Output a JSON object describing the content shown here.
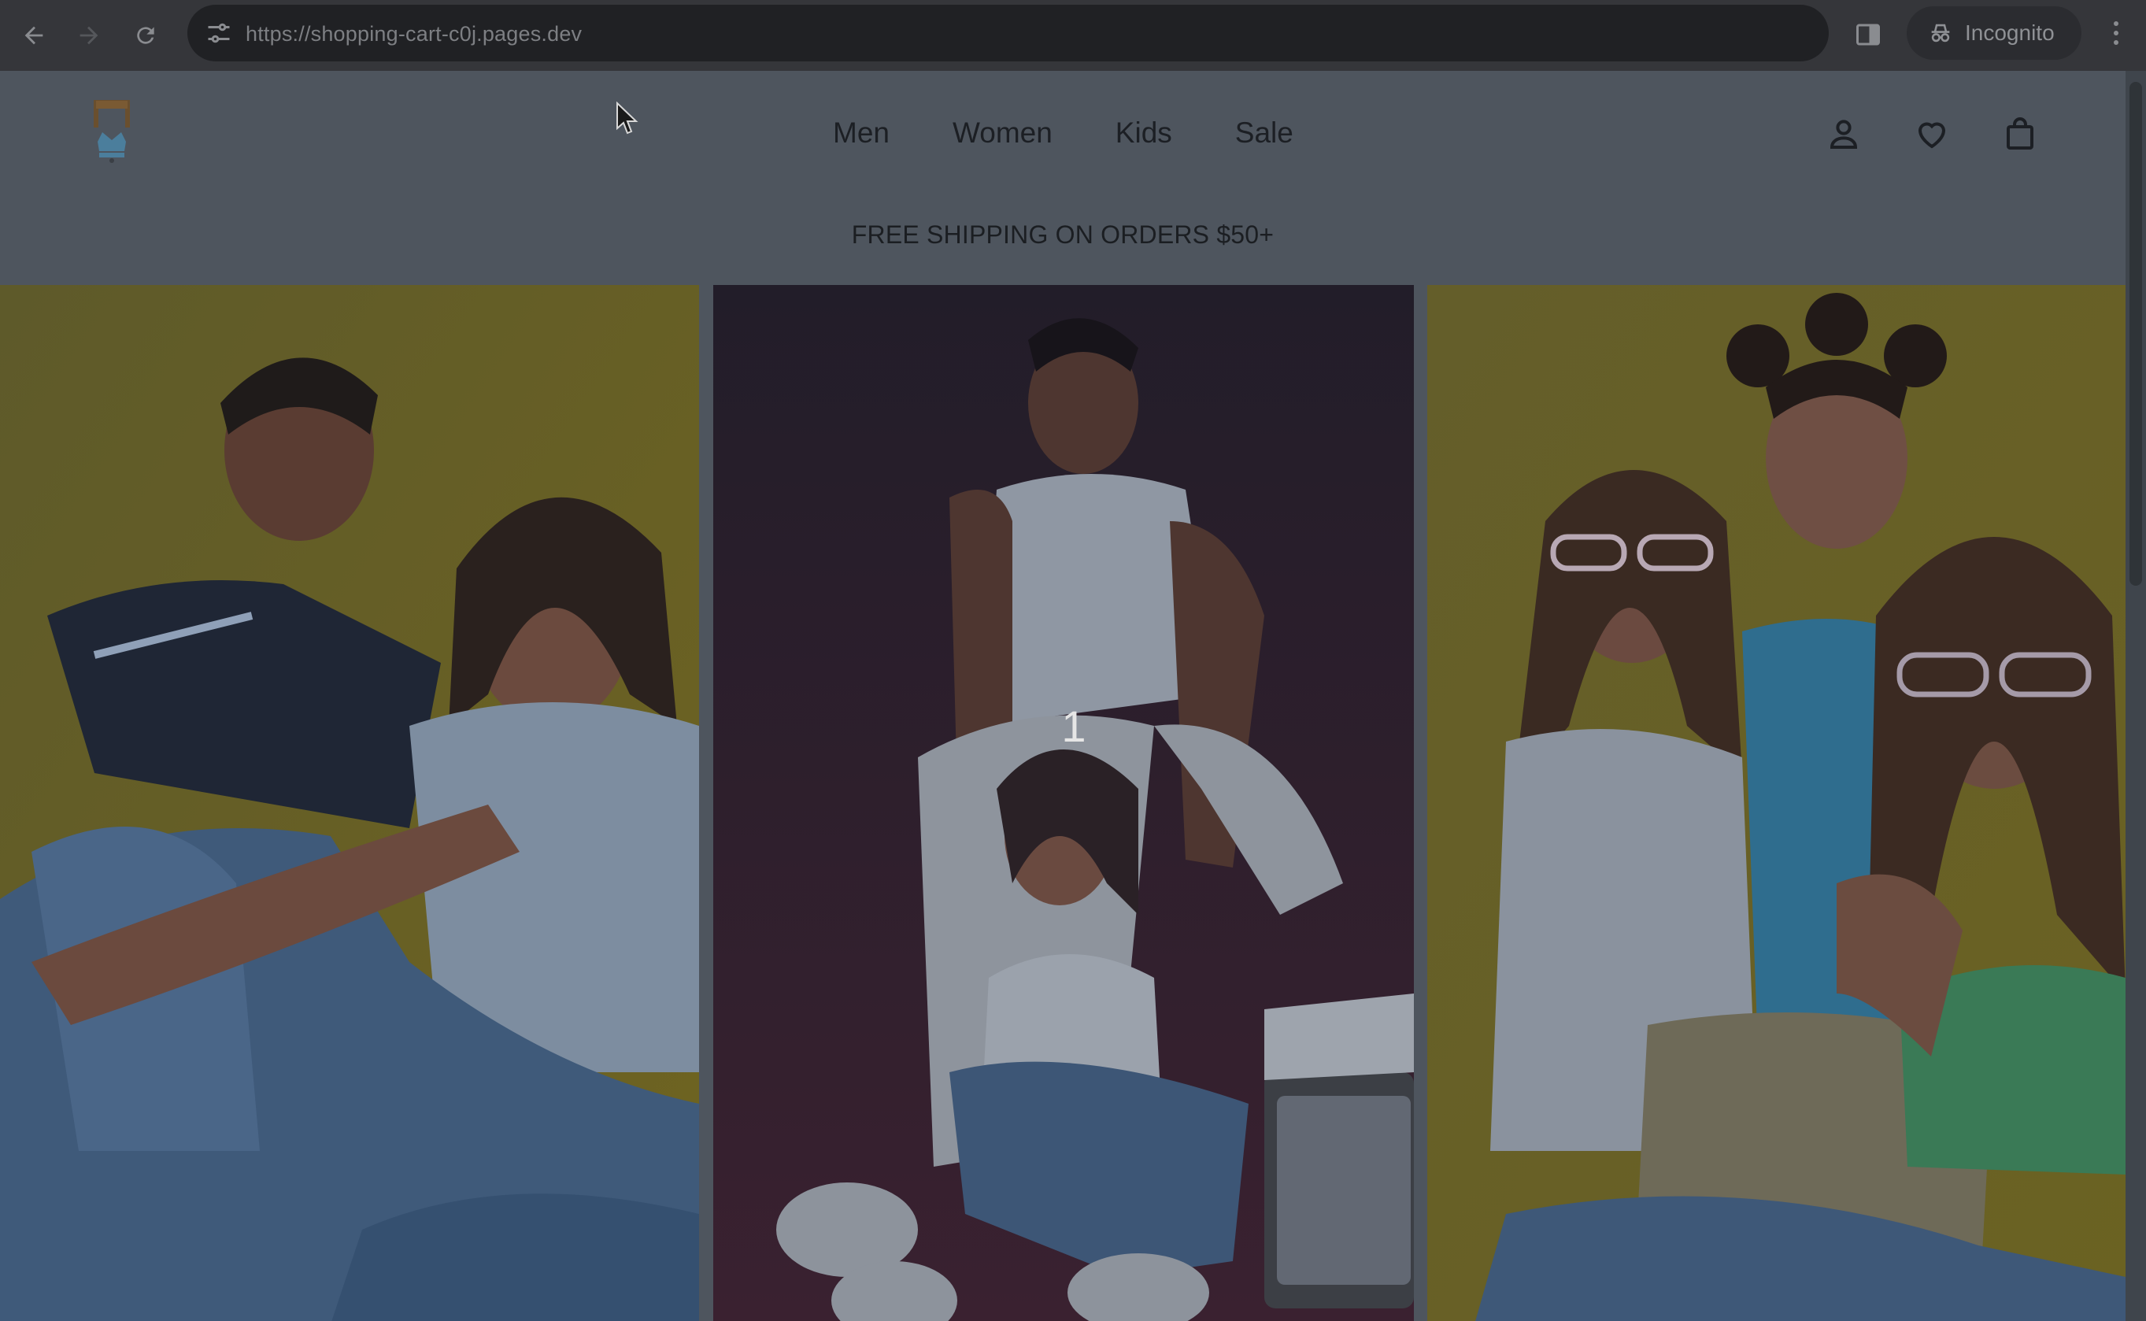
{
  "browser": {
    "back_icon": "arrow-left-icon",
    "forward_icon": "arrow-right-icon",
    "reload_icon": "reload-icon",
    "site_settings_icon": "tune-icon",
    "url": "https://shopping-cart-c0j.pages.dev",
    "side_panel_icon": "side-panel-icon",
    "incognito_label": "Incognito",
    "incognito_icon": "incognito-icon",
    "menu_icon": "more-vert-icon"
  },
  "header": {
    "logo_icon": "crown-bag-logo",
    "nav": [
      "Men",
      "Women",
      "Kids",
      "Sale"
    ],
    "account_icon": "user-icon",
    "wishlist_icon": "heart-icon",
    "cart_icon": "shopping-bag-icon"
  },
  "banner": {
    "text": "FREE SHIPPING ON ORDERS $50+"
  },
  "hero": {
    "slide_number": "1",
    "panels": [
      "couple-on-yellow-photo",
      "group-on-dark-red-photo",
      "three-friends-on-yellow-photo"
    ]
  },
  "colors": {
    "browser_bar": "#35363a",
    "page_overlay": "#4e555e",
    "yellow_backdrop": "#6f6420",
    "dark_backdrop": "#2a2230"
  }
}
